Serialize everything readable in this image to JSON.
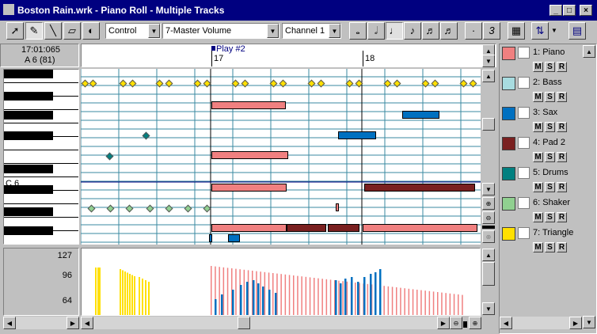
{
  "window": {
    "title": "Boston Rain.wrk - Piano Roll - Multiple Tracks"
  },
  "toolbar": {
    "control_type": "Control",
    "controller": "7-Master Volume",
    "channel": "Channel 1",
    "triplet_label": "3"
  },
  "position": {
    "time": "17:01:065",
    "pitch": "A 6 (81)"
  },
  "timeline": {
    "marker": "Play #2",
    "measures": [
      "17",
      "18"
    ]
  },
  "piano": {
    "c_label": "C 6"
  },
  "velocity": {
    "scale": [
      "127",
      "96",
      "64"
    ]
  },
  "tracks": [
    {
      "name": "1: Piano",
      "color": "#f08080"
    },
    {
      "name": "2: Bass",
      "color": "#a8dce0"
    },
    {
      "name": "3: Sax",
      "color": "#0070c0"
    },
    {
      "name": "4: Pad 2",
      "color": "#7a2020"
    },
    {
      "name": "5: Drums",
      "color": "#008080"
    },
    {
      "name": "6: Shaker",
      "color": "#90d090"
    },
    {
      "name": "7: Triangle",
      "color": "#ffe000"
    }
  ],
  "track_buttons": {
    "mute": "M",
    "solo": "S",
    "record": "R"
  }
}
